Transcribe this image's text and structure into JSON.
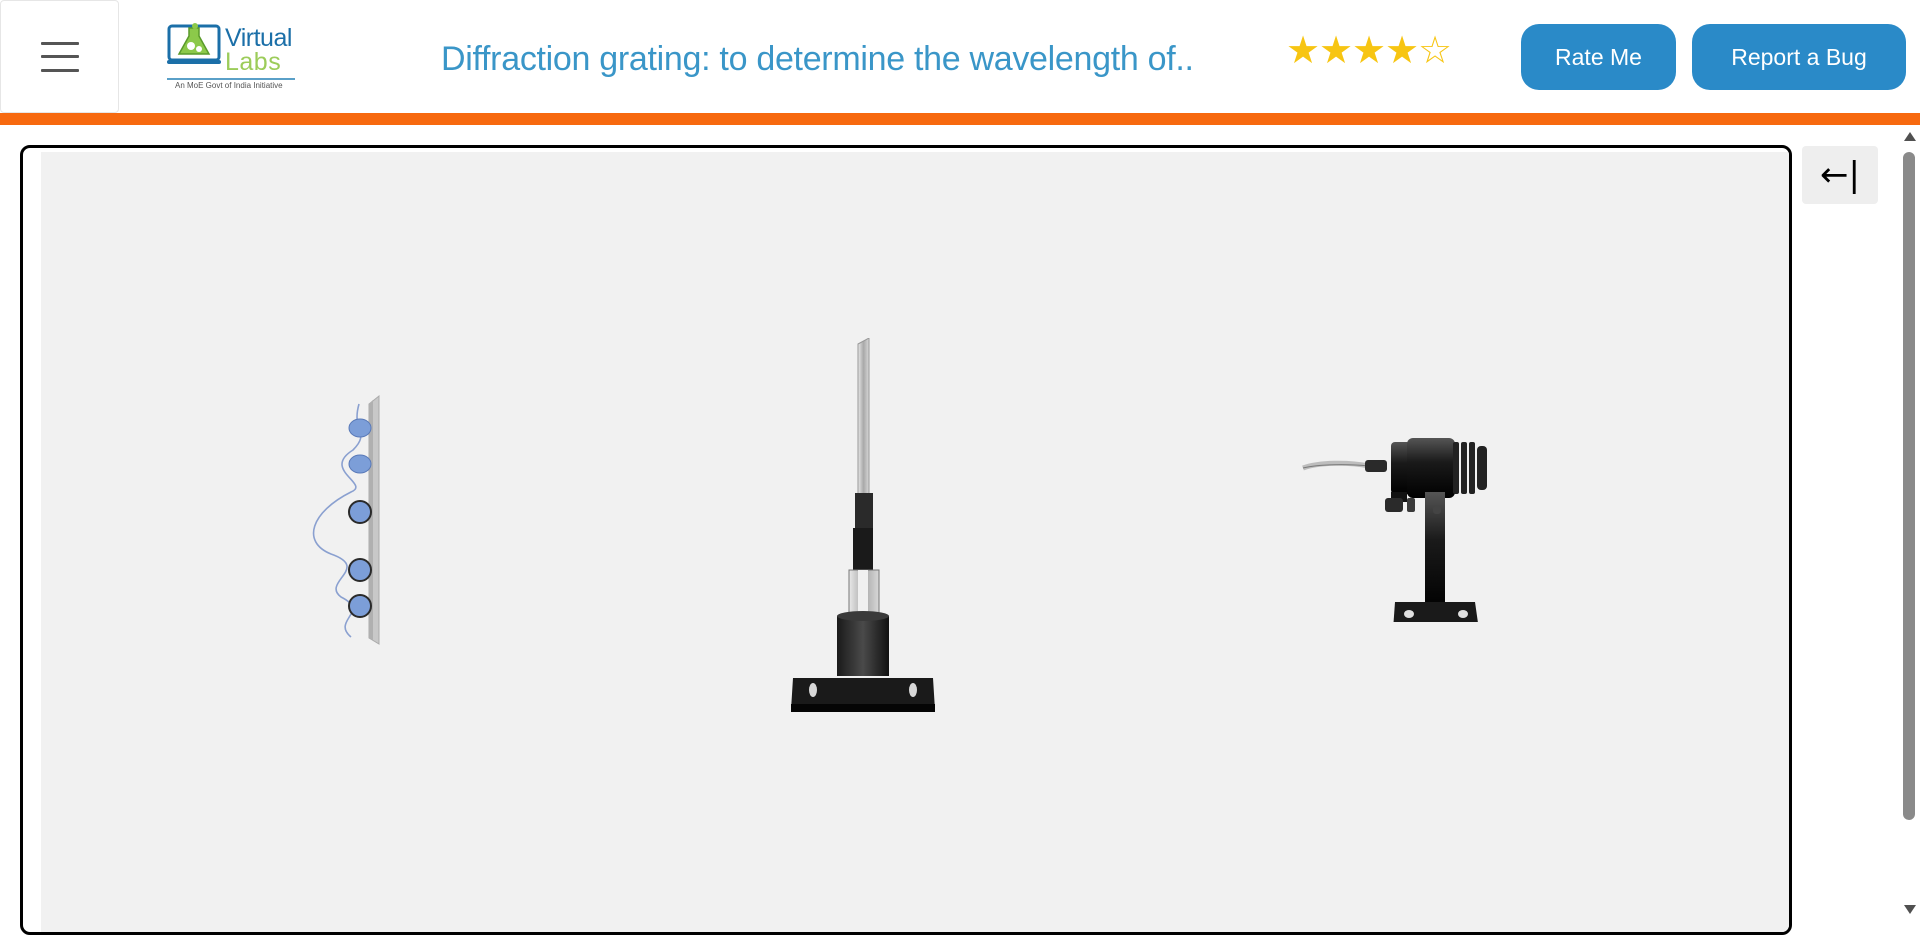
{
  "header": {
    "menu_icon": "hamburger-menu-icon",
    "logo": {
      "line1": "Virtual",
      "line2": "Labs",
      "tagline": "An MoE Govt of India Initiative"
    },
    "title": "Diffraction grating: to determine the wavelength of..",
    "rating": {
      "filled": 4,
      "max": 5,
      "color": "#f7c512",
      "full_glyph": "★",
      "empty_glyph": "☆"
    },
    "rate_button": "Rate Me",
    "bug_button": "Report a Bug"
  },
  "colors": {
    "accent_blue": "#2a8ac8",
    "title_blue": "#3a96c8",
    "orange_bar": "#f7690f",
    "canvas_bg": "#f1f1f1"
  },
  "sidebar_toggle": {
    "label": "←|",
    "icon": "collapse-arrow-icon"
  },
  "simulation": {
    "items": [
      {
        "name": "diffraction-screen",
        "icon": "screen-with-pattern-icon"
      },
      {
        "name": "grating-stand",
        "icon": "stand-icon"
      },
      {
        "name": "laser-source",
        "icon": "laser-icon"
      }
    ]
  }
}
